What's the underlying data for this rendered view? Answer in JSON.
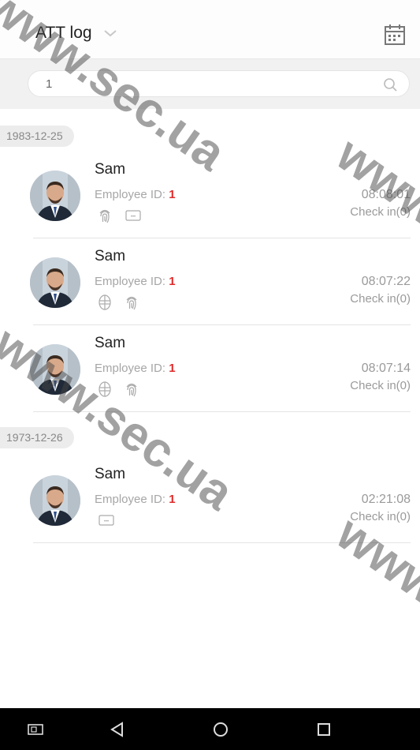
{
  "header": {
    "title": "ATT log",
    "icons": {
      "dropdown": "chevron-down-icon",
      "calendar": "calendar-icon"
    }
  },
  "search": {
    "value": "1",
    "icon": "search-icon"
  },
  "groups": [
    {
      "date": "1983-12-25",
      "records": [
        {
          "name": "Sam",
          "employee_label": "Employee ID:",
          "employee_id": "1",
          "time": "08:08:01",
          "status": "Check in(0)",
          "methods": [
            "fingerprint-icon",
            "card-icon"
          ]
        },
        {
          "name": "Sam",
          "employee_label": "Employee ID:",
          "employee_id": "1",
          "time": "08:07:22",
          "status": "Check in(0)",
          "methods": [
            "face-icon",
            "fingerprint-icon"
          ]
        },
        {
          "name": "Sam",
          "employee_label": "Employee ID:",
          "employee_id": "1",
          "time": "08:07:14",
          "status": "Check in(0)",
          "methods": [
            "face-icon",
            "fingerprint-icon"
          ]
        }
      ]
    },
    {
      "date": "1973-12-26",
      "records": [
        {
          "name": "Sam",
          "employee_label": "Employee ID:",
          "employee_id": "1",
          "time": "02:21:08",
          "status": "Check in(0)",
          "methods": [
            "card-icon"
          ]
        }
      ]
    }
  ],
  "navbar": {
    "icons": [
      "screenshot-icon",
      "back-icon",
      "home-icon",
      "recents-icon"
    ]
  },
  "watermark": "www.sec.ua",
  "colors": {
    "accent_red": "#e02b2b",
    "muted_text": "#9a9a9a",
    "navbar": "#000000"
  }
}
